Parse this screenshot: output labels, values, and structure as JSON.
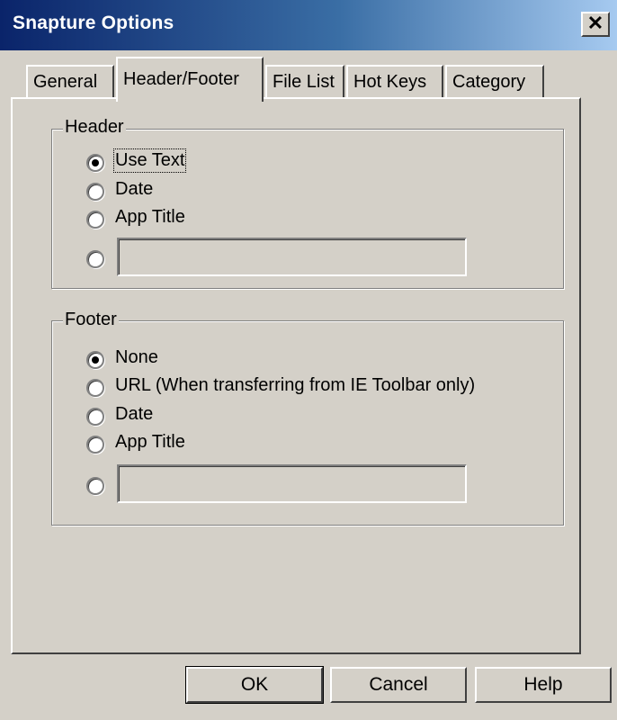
{
  "window": {
    "title": "Snapture Options",
    "close_label": "✕"
  },
  "tabs": [
    {
      "label": "General",
      "selected": false
    },
    {
      "label": "Header/Footer",
      "selected": true
    },
    {
      "label": "File List",
      "selected": false
    },
    {
      "label": "Hot Keys",
      "selected": false
    },
    {
      "label": "Category",
      "selected": false
    }
  ],
  "header_group": {
    "legend": "Header",
    "options": [
      "Use Text",
      "Date",
      "App Title"
    ],
    "selected": "Use Text",
    "custom_text_value": ""
  },
  "footer_group": {
    "legend": "Footer",
    "options": [
      "None",
      "URL (When transferring from IE Toolbar only)",
      "Date",
      "App Title"
    ],
    "selected": "None",
    "custom_text_value": ""
  },
  "buttons": {
    "ok": "OK",
    "cancel": "Cancel",
    "help": "Help"
  }
}
